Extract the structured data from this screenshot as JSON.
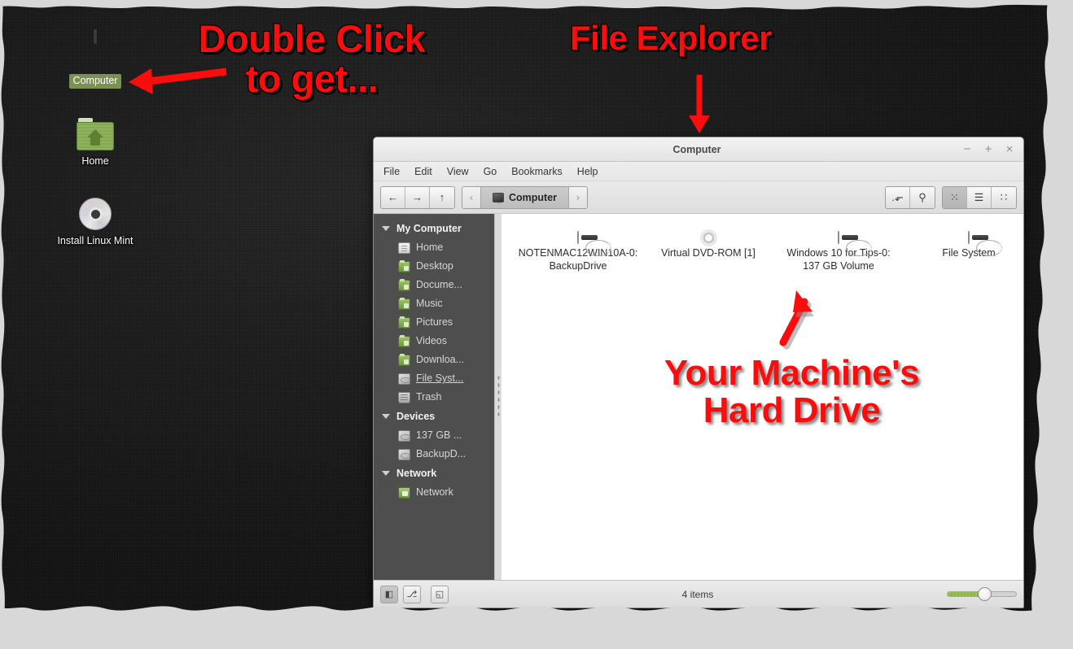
{
  "desktop": {
    "icons": [
      {
        "label": "Computer",
        "icon": "computer-monitor-icon",
        "selected": true
      },
      {
        "label": "Home",
        "icon": "home-folder-icon",
        "selected": false
      },
      {
        "label": "Install Linux Mint",
        "icon": "cd-disc-icon",
        "selected": false
      }
    ]
  },
  "annotations": {
    "double_click": "Double Click\nto get...",
    "file_explorer": "File Explorer",
    "hard_drive": "Your Machine's\nHard Drive",
    "color": "#fb0d0d"
  },
  "window": {
    "title": "Computer",
    "controls": {
      "minimize": "−",
      "maximize": "+",
      "close": "×"
    },
    "menu": [
      "File",
      "Edit",
      "View",
      "Go",
      "Bookmarks",
      "Help"
    ],
    "toolbar": {
      "back": "←",
      "forward": "→",
      "up": "↑",
      "crumb_prev": "‹",
      "crumb_next": "›",
      "current_path": "Computer",
      "path_entry_label": ".⬐",
      "search_label": "⚲",
      "view_icon_label": "⁙",
      "view_list_label": "☰",
      "view_compact_label": "∷",
      "active_view": "icon"
    },
    "sidebar": {
      "sections": [
        {
          "title": "My Computer",
          "items": [
            {
              "label": "Home",
              "icon": "document-icon",
              "hover": false
            },
            {
              "label": "Desktop",
              "icon": "folder-icon",
              "hover": false
            },
            {
              "label": "Docume...",
              "icon": "folder-icon",
              "hover": false
            },
            {
              "label": "Music",
              "icon": "folder-icon",
              "hover": false
            },
            {
              "label": "Pictures",
              "icon": "folder-icon",
              "hover": false
            },
            {
              "label": "Videos",
              "icon": "folder-icon",
              "hover": false
            },
            {
              "label": "Downloa...",
              "icon": "folder-icon",
              "hover": false
            },
            {
              "label": "File Syst...",
              "icon": "disk-icon",
              "hover": true
            },
            {
              "label": "Trash",
              "icon": "trash-icon",
              "hover": false
            }
          ]
        },
        {
          "title": "Devices",
          "items": [
            {
              "label": "137 GB ...",
              "icon": "disk-icon",
              "hover": false
            },
            {
              "label": "BackupD...",
              "icon": "disk-icon",
              "hover": false
            }
          ]
        },
        {
          "title": "Network",
          "items": [
            {
              "label": "Network",
              "icon": "network-icon",
              "hover": false
            }
          ]
        }
      ]
    },
    "files": [
      {
        "label": "NOTENMAC12WIN10A-0: BackupDrive",
        "icon": "hard-disk-icon"
      },
      {
        "label": "Virtual DVD-ROM [1]",
        "icon": "dvd-disc-icon"
      },
      {
        "label": "Windows 10 for Tips-0: 137 GB Volume",
        "icon": "hard-disk-icon"
      },
      {
        "label": "File System",
        "icon": "hard-disk-icon"
      }
    ],
    "statusbar": {
      "items_text": "4 items",
      "toggle_places": "◧",
      "toggle_tree": "⎇",
      "toggle_pane": "◱",
      "zoom_value": 50
    }
  }
}
